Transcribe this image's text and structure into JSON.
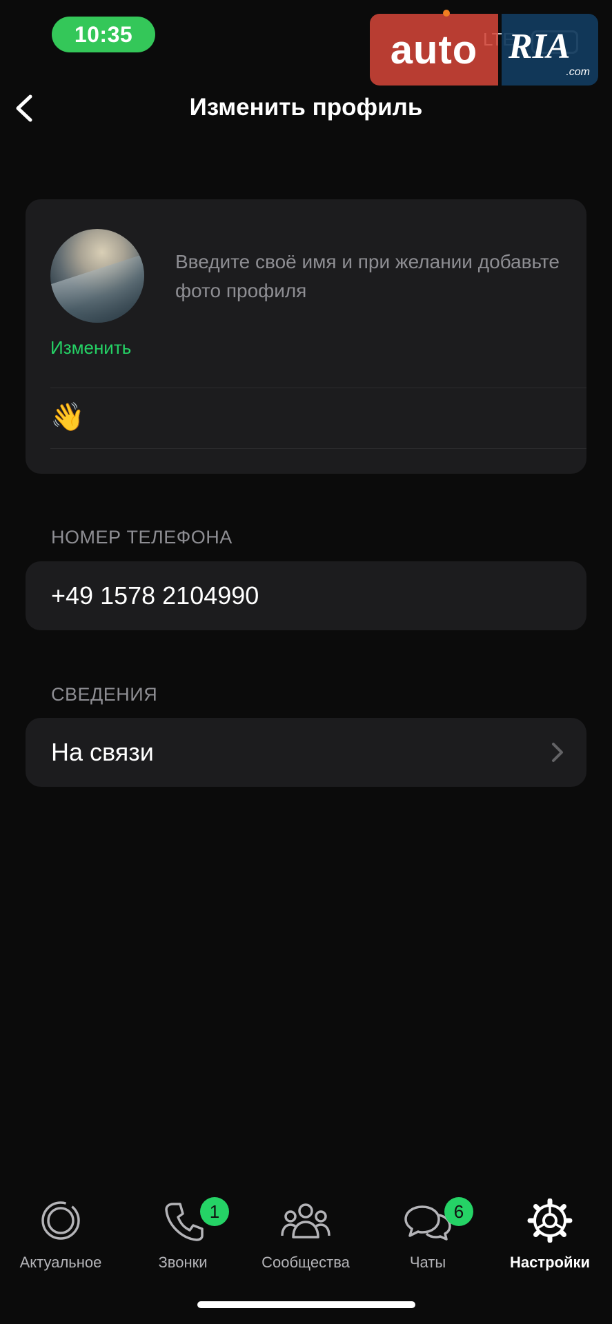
{
  "status_bar": {
    "time": "10:35",
    "network": "LTE",
    "watermark_auto": "auto",
    "watermark_ria": "RIA",
    "watermark_domain": ".com"
  },
  "header": {
    "title": "Изменить профиль",
    "back_icon": "chevron-left-icon"
  },
  "profile": {
    "hint": "Введите своё имя и при желании добавьте фото профиля",
    "edit_label": "Изменить",
    "name_value": "👋"
  },
  "phone_section": {
    "label": "НОМЕР ТЕЛЕФОНА",
    "value": "+49 1578 2104990"
  },
  "about_section": {
    "label": "СВЕДЕНИЯ",
    "value": "На связи"
  },
  "tabs": [
    {
      "label": "Актуальное",
      "icon": "status-icon",
      "active": false
    },
    {
      "label": "Звонки",
      "icon": "phone-icon",
      "badge": "1",
      "active": false
    },
    {
      "label": "Сообщества",
      "icon": "communities-icon",
      "active": false
    },
    {
      "label": "Чаты",
      "icon": "chats-icon",
      "badge": "6",
      "active": false
    },
    {
      "label": "Настройки",
      "icon": "settings-icon",
      "active": true
    }
  ],
  "colors": {
    "background": "#0b0b0b",
    "card": "#1c1c1e",
    "accent": "#25d366",
    "secondary_text": "#8e8e93"
  }
}
